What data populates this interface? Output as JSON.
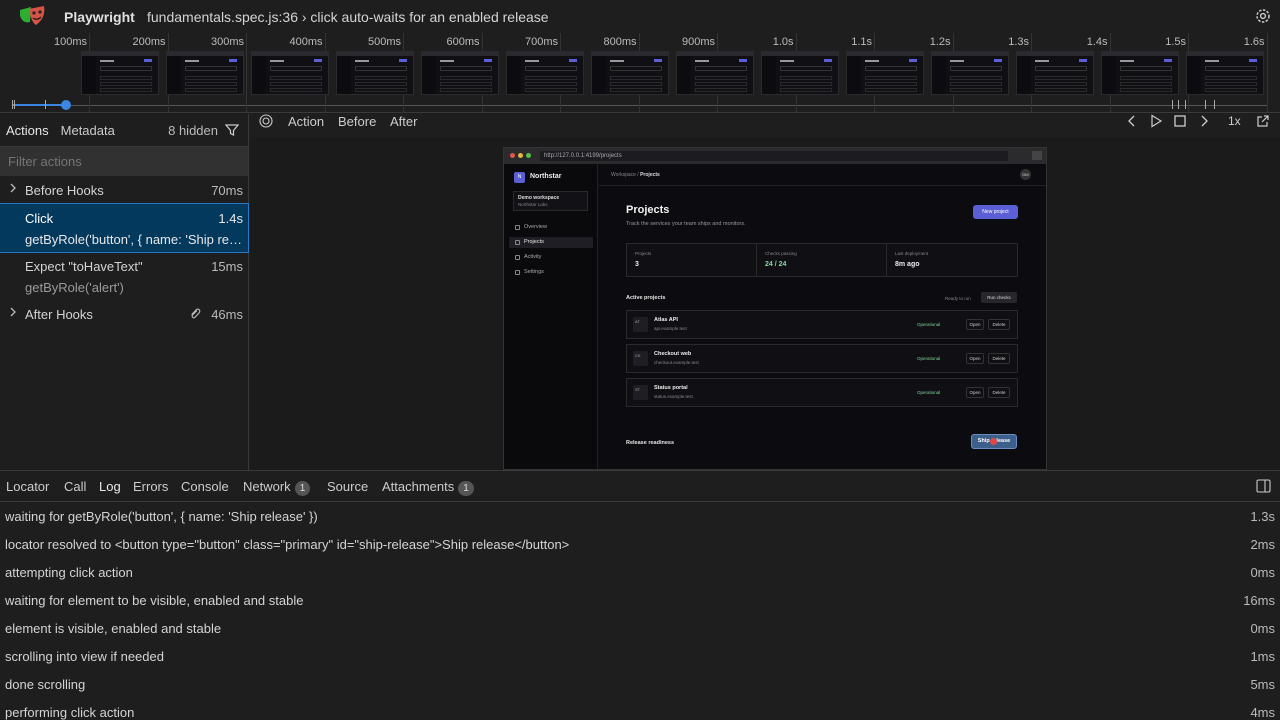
{
  "header": {
    "app_name": "Playwright",
    "title": "fundamentals.spec.js:36 › click auto-waits for an enabled release"
  },
  "timeline": {
    "ticks": [
      "100ms",
      "200ms",
      "300ms",
      "400ms",
      "500ms",
      "600ms",
      "700ms",
      "800ms",
      "900ms",
      "1.0s",
      "1.1s",
      "1.2s",
      "1.3s",
      "1.4s",
      "1.5s",
      "1.6s"
    ]
  },
  "actions_panel": {
    "tabs": [
      "Actions",
      "Metadata"
    ],
    "hidden_label": "8 hidden",
    "filter_placeholder": "Filter actions",
    "items": [
      {
        "name": "Before Hooks",
        "time": "70ms"
      },
      {
        "name": "Click",
        "time": "1.4s",
        "sub": "getByRole('button', { name: 'Ship release' })"
      },
      {
        "name": "Expect \"toHaveText\"",
        "time": "15ms",
        "sub": "getByRole('alert')"
      },
      {
        "name": "After Hooks",
        "time": "46ms"
      }
    ]
  },
  "snapshot_tabs": [
    "Action",
    "Before",
    "After"
  ],
  "speed": "1x",
  "snapshot": {
    "url": "http://127.0.0.1:4199/projects",
    "brand": "Northstar",
    "brand_initial": "N",
    "workspace_name": "Demo workspace",
    "workspace_org": "Northstar Labs",
    "nav": [
      "Overview",
      "Projects",
      "Activity",
      "Settings"
    ],
    "crumb_parent": "Workspace / ",
    "crumb_current": "Projects",
    "avatar": "DM",
    "page_title": "Projects",
    "page_subtitle": "Track the services your team ships and monitors.",
    "new_project": "New project",
    "stats": [
      {
        "label": "Projects",
        "value": "3"
      },
      {
        "label": "Checks passing",
        "value": "24 / 24"
      },
      {
        "label": "Last deployment",
        "value": "8m ago"
      }
    ],
    "section_title": "Active projects",
    "ready_label": "Ready to run",
    "run_checks": "Run checks",
    "projects": [
      {
        "initials": "AT",
        "name": "Atlas API",
        "host": "api.example.test",
        "status": "Operational"
      },
      {
        "initials": "CK",
        "name": "Checkout web",
        "host": "checkout.example.test",
        "status": "Operational"
      },
      {
        "initials": "ST",
        "name": "Status portal",
        "host": "status.example.test",
        "status": "Operational"
      }
    ],
    "open_label": "Open",
    "delete_label": "Delete",
    "readiness": "Release readiness",
    "ship_label": "Ship release"
  },
  "bottom_tabs": [
    {
      "label": "Locator"
    },
    {
      "label": "Call"
    },
    {
      "label": "Log"
    },
    {
      "label": "Errors"
    },
    {
      "label": "Console"
    },
    {
      "label": "Network",
      "badge": "1"
    },
    {
      "label": "Source"
    },
    {
      "label": "Attachments",
      "badge": "1"
    }
  ],
  "log": [
    {
      "text": "waiting for getByRole('button', { name: 'Ship release' })",
      "time": "1.3s"
    },
    {
      "text": "locator resolved to <button type=\"button\" class=\"primary\" id=\"ship-release\">Ship release</button>",
      "time": "2ms"
    },
    {
      "text": "attempting click action",
      "time": "0ms"
    },
    {
      "text": "waiting for element to be visible, enabled and stable",
      "time": "16ms"
    },
    {
      "text": "element is visible, enabled and stable",
      "time": "0ms"
    },
    {
      "text": "scrolling into view if needed",
      "time": "1ms"
    },
    {
      "text": "done scrolling",
      "time": "5ms"
    },
    {
      "text": "performing click action",
      "time": "4ms"
    }
  ],
  "colors": {
    "accent": "#5b5fd6",
    "selection": "#04395e",
    "operational": "#7fd39a"
  }
}
